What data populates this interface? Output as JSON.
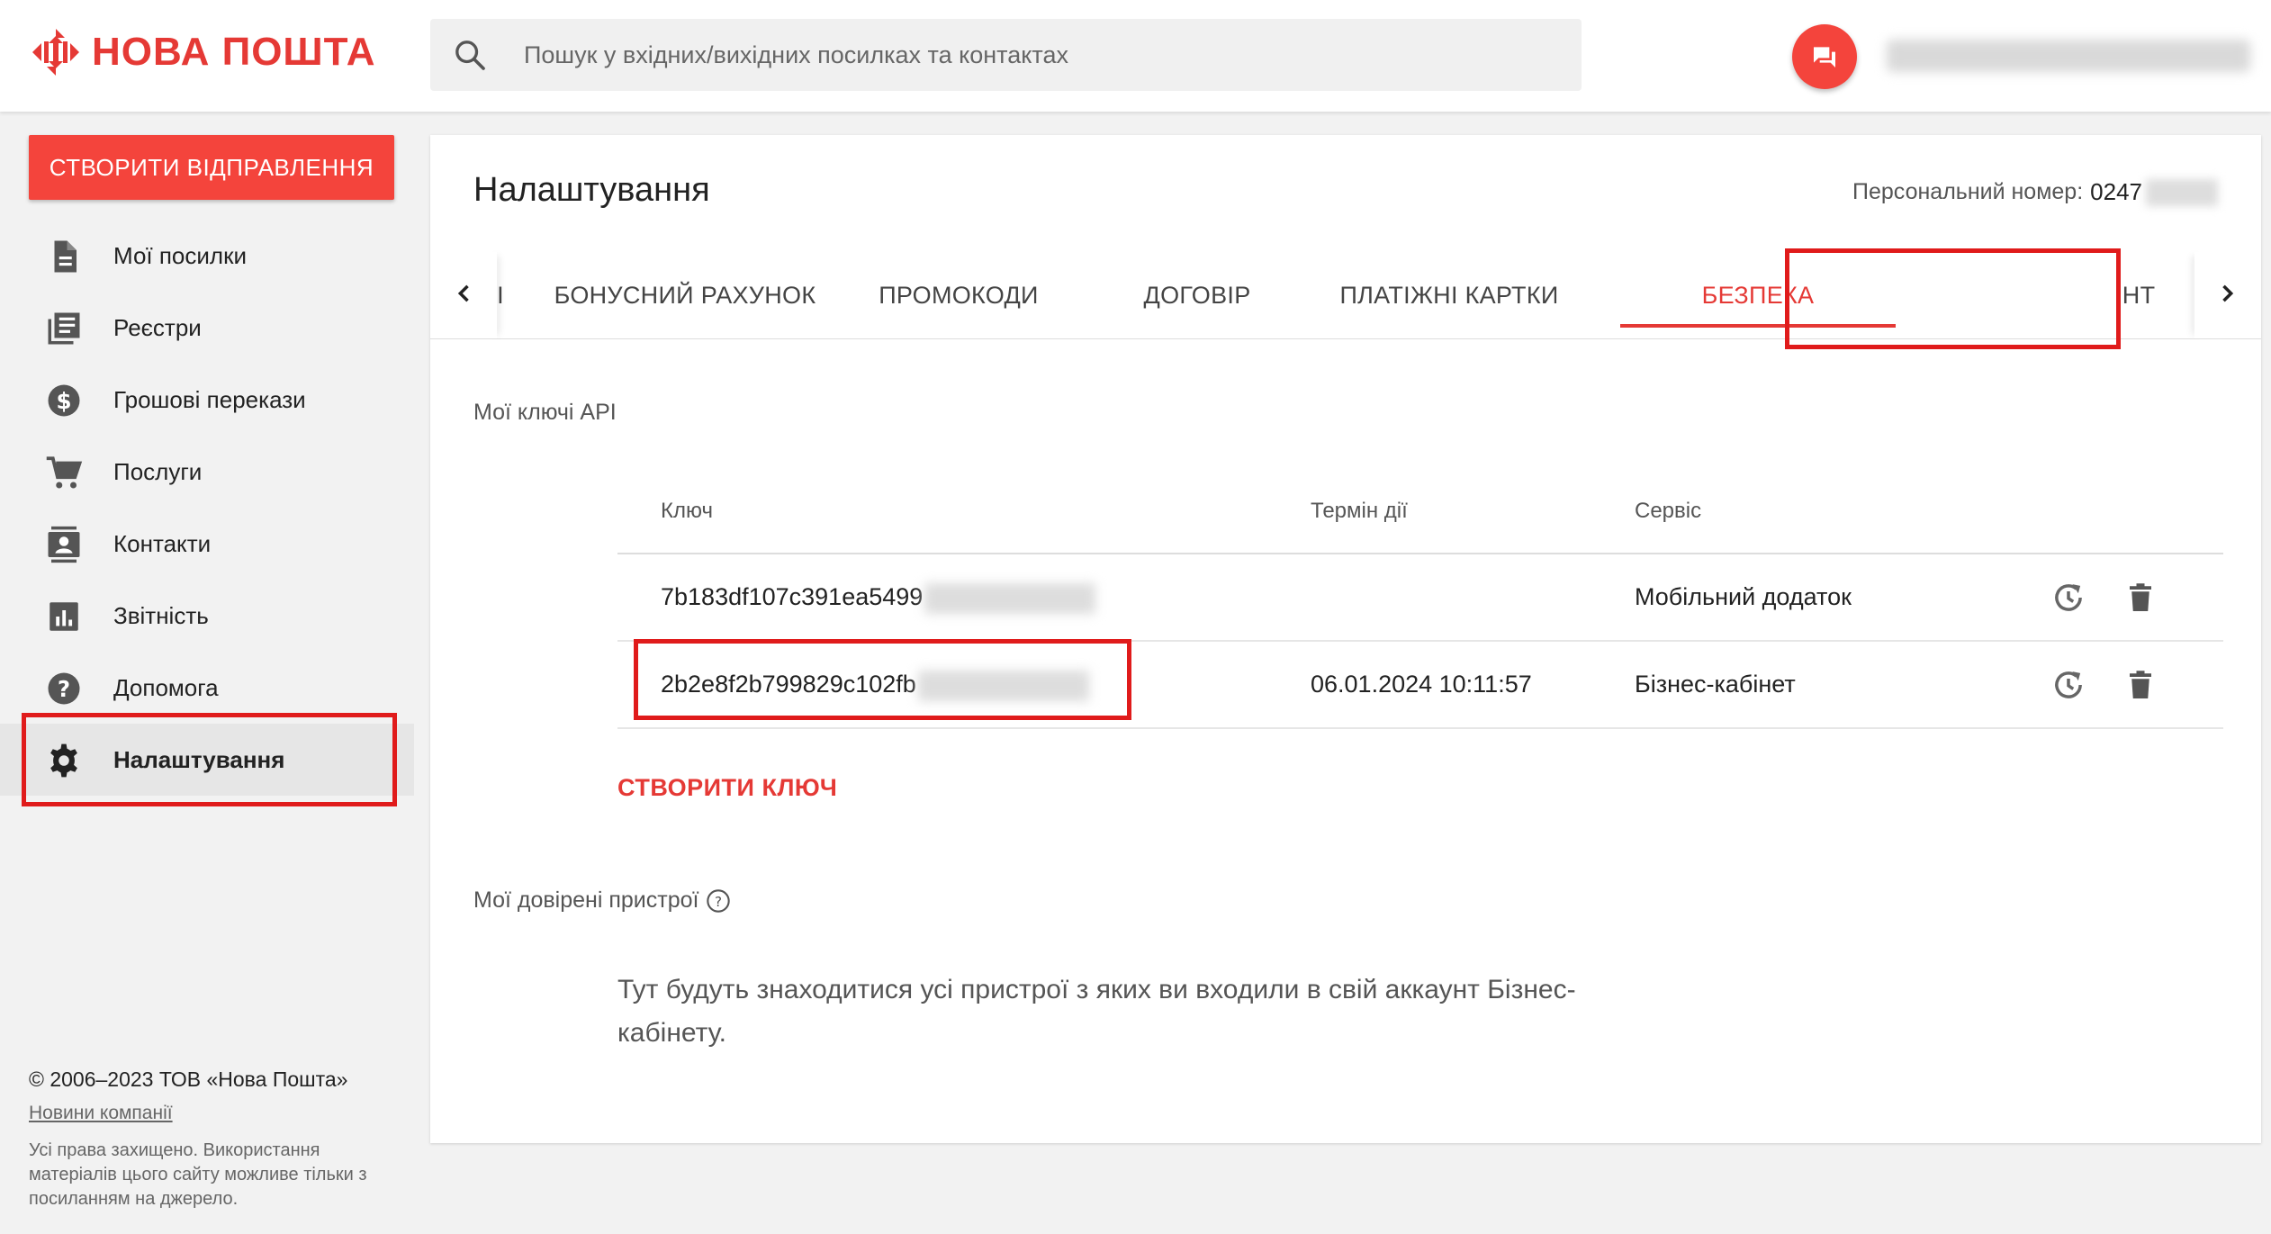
{
  "brand": {
    "name": "НОВА ПОШТА",
    "color": "#e53935"
  },
  "search": {
    "placeholder": "Пошук у вхідних/вихідних посилках та контактах",
    "icon": "search-icon"
  },
  "header": {
    "chat_icon": "chat-icon"
  },
  "sidebar": {
    "create_button": "СТВОРИТИ ВІДПРАВЛЕННЯ",
    "items": [
      {
        "label": "Мої посилки",
        "icon": "document-icon"
      },
      {
        "label": "Реєстри",
        "icon": "registry-icon"
      },
      {
        "label": "Грошові перекази",
        "icon": "dollar-icon"
      },
      {
        "label": "Послуги",
        "icon": "cart-icon"
      },
      {
        "label": "Контакти",
        "icon": "contacts-icon"
      },
      {
        "label": "Звітність",
        "icon": "chart-icon"
      },
      {
        "label": "Допомога",
        "icon": "help-icon"
      },
      {
        "label": "Налаштування",
        "icon": "gear-icon",
        "active": true
      }
    ]
  },
  "footer": {
    "copyright": "© 2006–2023 ТОВ «Нова Пошта»",
    "news_link": "Новини компанії",
    "rights": "Усі права захищено. Використання матеріалів цього сайту можливе тільки з посиланням на джерело."
  },
  "main": {
    "title": "Налаштування",
    "personal_label": "Персональний номер:",
    "personal_number": "0247",
    "tabs": [
      {
        "label": "І"
      },
      {
        "label": "БОНУСНИЙ РАХУНОК"
      },
      {
        "label": "ПРОМОКОДИ"
      },
      {
        "label": "ДОГОВІР"
      },
      {
        "label": "ПЛАТІЖНІ КАРТКИ"
      },
      {
        "label": "БЕЗПЕКА",
        "active": true
      },
      {
        "label": "ІНТ"
      }
    ],
    "api_section_title": "Мої ключі API",
    "table": {
      "headers": {
        "key": "Ключ",
        "expiry": "Термін дії",
        "service": "Сервіс"
      },
      "rows": [
        {
          "key": "7b183df107c391ea5499",
          "expiry": "",
          "service": "Мобільний додаток"
        },
        {
          "key": "2b2e8f2b799829c102fb",
          "expiry": "06.01.2024 10:11:57",
          "service": "Бізнес-кабінет"
        }
      ]
    },
    "create_key": "СТВОРИТИ КЛЮЧ",
    "devices_title": "Мої довірені пристрої",
    "devices_text": "Тут будуть знаходитися усі пристрої з яких ви входили в свій аккаунт Бізнес-кабінету."
  },
  "highlight_color": "#e01b1b"
}
